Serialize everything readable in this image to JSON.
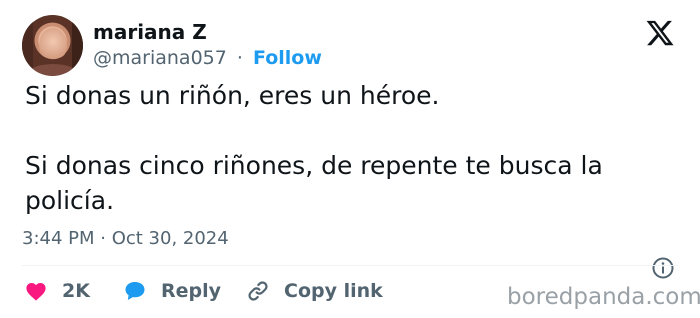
{
  "author": {
    "name": "mariana Z",
    "handle": "@mariana057",
    "separator": "·",
    "follow_label": "Follow"
  },
  "tweet": {
    "paragraphs": [
      "Si donas un riñón, eres un héroe.",
      "Si donas cinco riñones, de repente te busca la policía."
    ],
    "timestamp": "3:44 PM · Oct 30, 2024"
  },
  "actions": {
    "like_count": "2K",
    "reply_label": "Reply",
    "copy_label": "Copy link"
  },
  "watermark": "boredpanda.com",
  "icons": {
    "brand": "x-logo-icon",
    "like": "heart-icon",
    "reply": "speech-bubble-icon",
    "copy": "link-icon",
    "info": "info-icon"
  },
  "colors": {
    "text": "#0f1419",
    "muted": "#536471",
    "accent": "#1d9bf0",
    "like": "#f91880",
    "divider": "#eff3f4"
  }
}
